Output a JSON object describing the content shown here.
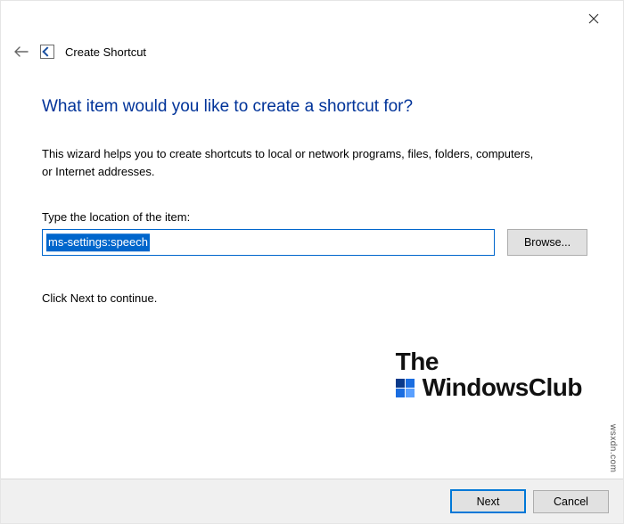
{
  "window": {
    "title": "Create Shortcut"
  },
  "main": {
    "heading": "What item would you like to create a shortcut for?",
    "description": "This wizard helps you to create shortcuts to local or network programs, files, folders, computers, or Internet addresses.",
    "location_label": "Type the location of the item:",
    "location_value": "ms-settings:speech",
    "browse_label": "Browse...",
    "hint": "Click Next to continue."
  },
  "watermark": {
    "line1": "The",
    "line2": "WindowsClub"
  },
  "footer": {
    "next_label": "Next",
    "cancel_label": "Cancel"
  },
  "source_tag": "wsxdn.com"
}
